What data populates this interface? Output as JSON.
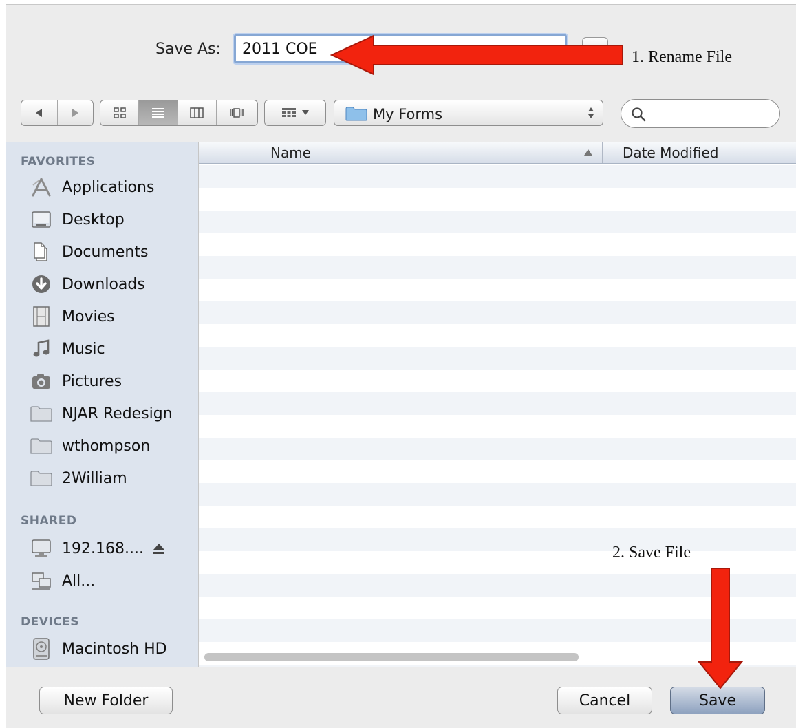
{
  "save_as": {
    "label": "Save As:",
    "filename": "2011 COE"
  },
  "toolbar": {
    "view_icons": [
      "back-icon",
      "forward-icon",
      "icon-view-icon",
      "list-view-icon",
      "column-view-icon",
      "coverflow-view-icon",
      "arrange-icon"
    ],
    "location": "My Forms",
    "search_placeholder": ""
  },
  "sidebar": {
    "favorites_header": "FAVORITES",
    "favorites": [
      {
        "label": "Applications",
        "icon": "applications-icon"
      },
      {
        "label": "Desktop",
        "icon": "desktop-icon"
      },
      {
        "label": "Documents",
        "icon": "documents-icon"
      },
      {
        "label": "Downloads",
        "icon": "downloads-icon"
      },
      {
        "label": "Movies",
        "icon": "movies-icon"
      },
      {
        "label": "Music",
        "icon": "music-icon"
      },
      {
        "label": "Pictures",
        "icon": "pictures-icon"
      },
      {
        "label": "NJAR Redesign",
        "icon": "folder-icon"
      },
      {
        "label": "wthompson",
        "icon": "folder-icon"
      },
      {
        "label": "2William",
        "icon": "folder-icon"
      }
    ],
    "shared_header": "SHARED",
    "shared": [
      {
        "label": "192.168....",
        "icon": "computer-icon"
      },
      {
        "label": "All...",
        "icon": "network-icon"
      }
    ],
    "devices_header": "DEVICES",
    "devices": [
      {
        "label": "Macintosh HD",
        "icon": "hard-drive-icon"
      }
    ]
  },
  "file_list": {
    "columns": [
      "Name",
      "Date Modified"
    ],
    "rows": []
  },
  "buttons": {
    "new_folder": "New Folder",
    "cancel": "Cancel",
    "save": "Save"
  },
  "annotations": {
    "rename": "1. Rename File",
    "save": "2. Save File",
    "arrow_color": "#f2230e"
  },
  "colors": {
    "sidebar_bg": "#dde4ee",
    "focus_ring": "#86a7d4",
    "default_button": "#8ea2bf"
  }
}
